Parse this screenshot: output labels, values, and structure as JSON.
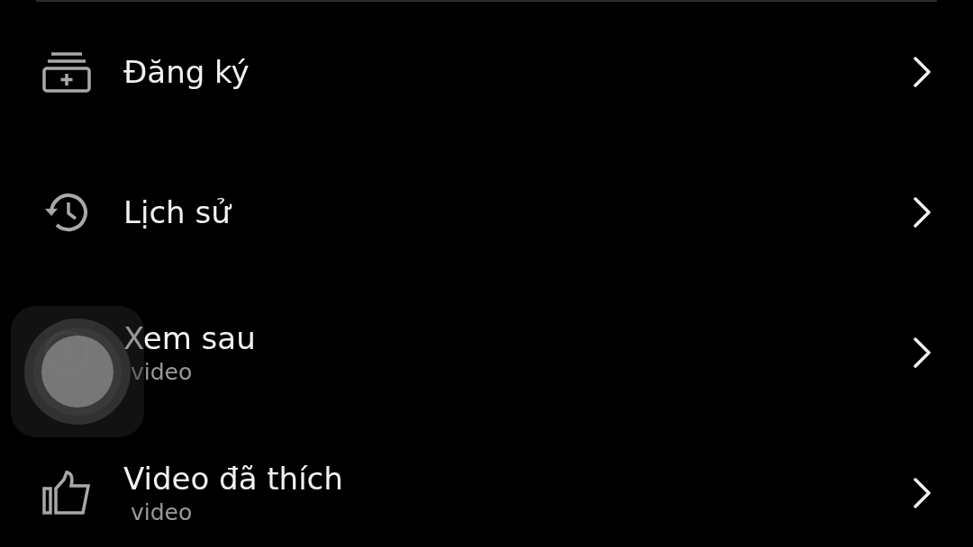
{
  "menu": [
    {
      "kind": "subscriptions",
      "title": "Đăng ký"
    },
    {
      "kind": "history",
      "title": "Lịch sử"
    },
    {
      "kind": "watch-later",
      "title": "Xem sau",
      "subtitle": "video"
    },
    {
      "kind": "liked",
      "title": "Video đã thích",
      "subtitle": "video"
    }
  ],
  "assistive_touch": {
    "kind": "floating-button"
  }
}
